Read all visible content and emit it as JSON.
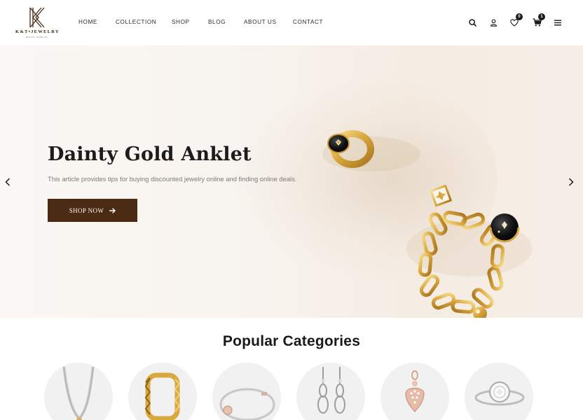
{
  "brand": {
    "logo_text": "K&T•JEWELRY",
    "tagline": "BRAND JEWELRY"
  },
  "nav": [
    "HOME",
    "COLLECTION",
    "SHOP",
    "BLOG",
    "ABOUT US",
    "CONTACT"
  ],
  "header_icons": {
    "search": "search-icon",
    "account": "user-icon",
    "wishlist": {
      "icon": "heart-icon",
      "count": "0"
    },
    "cart": {
      "icon": "cart-icon",
      "count": "1"
    },
    "menu": "hamburger-icon"
  },
  "hero": {
    "title": "Dainty Gold Anklet",
    "subtitle": "This article provides tips for buying discounted jewelry online and finding online deals.",
    "button_label": "SHOP NOW",
    "prev_icon": "chevron-left-icon",
    "next_icon": "chevron-right-icon"
  },
  "categories": {
    "title": "Popular Categories",
    "items": [
      "necklace-image",
      "ring-image",
      "bracelet-image",
      "earrings-image",
      "pendant-image",
      "diamond-ring-image"
    ]
  },
  "colors": {
    "accent": "#4a2a12",
    "hero_bg": "#f8f3ee",
    "circle_bg": "#f1f1f1"
  }
}
